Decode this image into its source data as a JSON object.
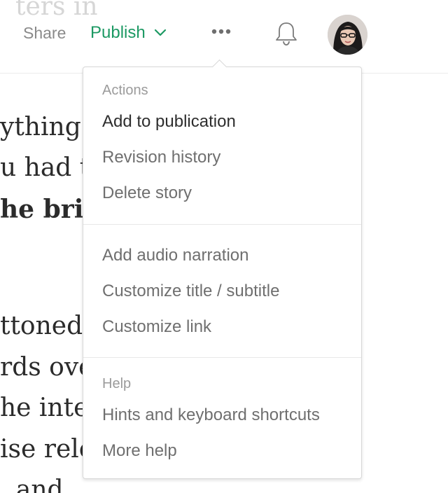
{
  "header": {
    "title_fragment": "ters in",
    "share_label": "Share",
    "publish_label": "Publish",
    "more_icon": "more-horizontal-icon",
    "notifications_icon": "bell-icon",
    "avatar_alt": "User avatar",
    "accent_color": "#1c9963"
  },
  "article": {
    "lines": [
      "ything i",
      "u had to",
      "he brim",
      "ttoned o",
      "rds over",
      "he intern",
      "ise relev",
      ", and"
    ]
  },
  "menu": {
    "actions_heading": "Actions",
    "actions": [
      "Add to publication",
      "Revision history",
      "Delete story"
    ],
    "customize": [
      "Add audio narration",
      "Customize title / subtitle",
      "Customize link"
    ],
    "help_heading": "Help",
    "help": [
      "Hints and keyboard shortcuts",
      "More help"
    ]
  }
}
